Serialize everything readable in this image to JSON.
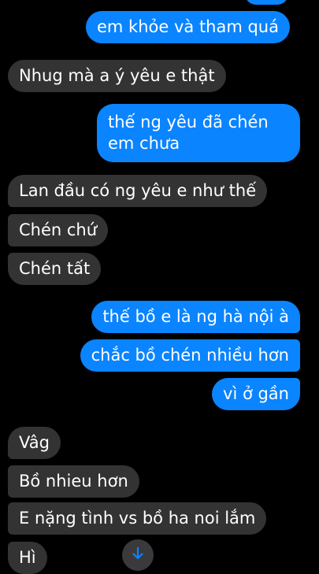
{
  "colors": {
    "background": "#000000",
    "outgoing_bubble": "#0a84ff",
    "incoming_bubble": "#333333",
    "text": "#ffffff"
  },
  "messages": [
    {
      "dir": "out",
      "text": "em khỏe và tham quá"
    },
    {
      "dir": "in",
      "text": "Nhug mà a ý yêu e thật"
    },
    {
      "dir": "out",
      "text": "thế ng yêu đã chén em chưa"
    },
    {
      "dir": "in",
      "text": "Lan đầu có ng yêu e như thế"
    },
    {
      "dir": "in",
      "text": "Chén chứ"
    },
    {
      "dir": "in",
      "text": "Chén tất"
    },
    {
      "dir": "out",
      "text": "thế bồ e là ng hà nội à"
    },
    {
      "dir": "out",
      "text": "chắc bồ chén nhiều hơn"
    },
    {
      "dir": "out",
      "text": "vì ở gần"
    },
    {
      "dir": "in",
      "text": "Vâg"
    },
    {
      "dir": "in",
      "text": "Bồ nhieu hơn"
    },
    {
      "dir": "in",
      "text": "E nặng tình vs bồ ha noi lắm"
    },
    {
      "dir": "in",
      "text": "Hì"
    }
  ],
  "scroll_button": {
    "icon": "arrow-down-icon",
    "color": "#0a84ff"
  }
}
